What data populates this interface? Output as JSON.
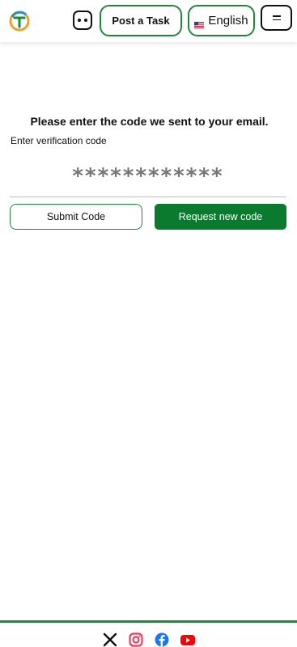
{
  "header": {
    "logo_icon": "app-logo-icon",
    "chat_icon": "chat-icon",
    "post_task_label": "Post a Task",
    "language": {
      "flag_icon": "us-flag-icon",
      "label": "English"
    },
    "menu_icon": "hamburger-menu-icon"
  },
  "verify": {
    "heading": "Please enter the code we sent to your email.",
    "input_label": "Enter verification code",
    "input_placeholder": "************",
    "submit_label": "Submit Code",
    "request_label": "Request new code"
  },
  "footer": {
    "socials": [
      "x-icon",
      "instagram-icon",
      "facebook-icon",
      "youtube-icon"
    ]
  },
  "colors": {
    "brand_green": "#1b8a37",
    "button_green": "#0a7a2f",
    "instagram": "#e4405f",
    "facebook": "#1877f2",
    "youtube": "#ff0000"
  }
}
